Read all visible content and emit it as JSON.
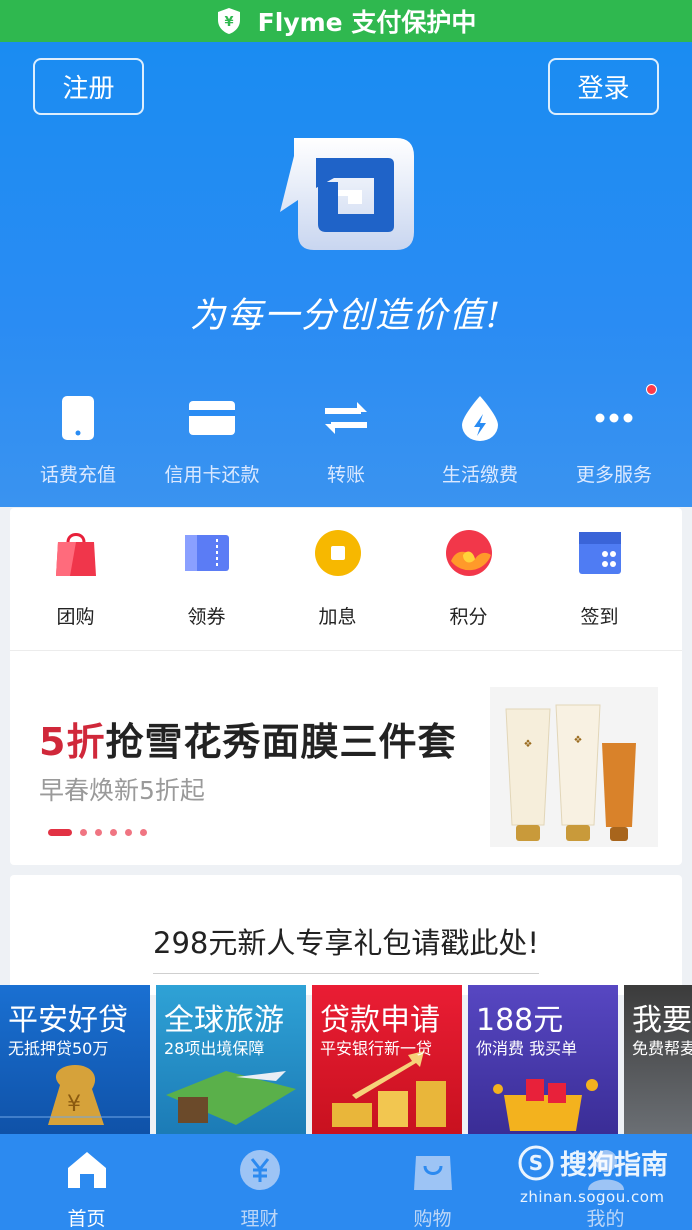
{
  "status_bar": {
    "text": "Flyme 支付保护中",
    "shield_glyph": "¥"
  },
  "header": {
    "register_label": "注册",
    "login_label": "登录",
    "slogan": "为每一分创造价值!"
  },
  "services": [
    {
      "label": "话费充值",
      "icon": "phone-icon"
    },
    {
      "label": "信用卡还款",
      "icon": "credit-card-icon"
    },
    {
      "label": "转账",
      "icon": "transfer-icon"
    },
    {
      "label": "生活缴费",
      "icon": "utility-drop-icon"
    },
    {
      "label": "更多服务",
      "icon": "more-icon",
      "badge": true
    }
  ],
  "quick_grid": [
    {
      "label": "团购",
      "icon": "shopping-bag-icon"
    },
    {
      "label": "领券",
      "icon": "coupon-icon"
    },
    {
      "label": "加息",
      "icon": "coin-icon"
    },
    {
      "label": "积分",
      "icon": "points-icon"
    },
    {
      "label": "签到",
      "icon": "calendar-icon"
    }
  ],
  "banner": {
    "highlight": "5折",
    "title": "抢雪花秀面膜三件套",
    "subtitle": "早春焕新5折起",
    "page_count": 6,
    "active_page": 1
  },
  "promo": {
    "text": "298元新人专享礼包请戳此处!"
  },
  "tiles": [
    {
      "title": "平安好贷",
      "subtitle": "无抵押贷50万",
      "color": "#1d6fd0"
    },
    {
      "title": "全球旅游",
      "subtitle": "28项出境保障",
      "color": "#2aa8d8"
    },
    {
      "title": "贷款申请",
      "subtitle": "平安银行新一贷",
      "color": "#e01d2f"
    },
    {
      "title": "188元",
      "subtitle": "你消费 我买单",
      "color": "#4b3fb0"
    },
    {
      "title": "我要",
      "subtitle": "免费帮麦",
      "color": "#3a3a3a"
    }
  ],
  "bottom_nav": [
    {
      "label": "首页",
      "icon": "home-icon",
      "active": true
    },
    {
      "label": "理财",
      "icon": "yuan-icon",
      "active": false
    },
    {
      "label": "购物",
      "icon": "bag-icon",
      "active": false
    },
    {
      "label": "我的",
      "icon": "user-icon",
      "active": false
    }
  ],
  "watermark": {
    "brand": "搜狗指南",
    "url": "zhinan.sogou.com"
  }
}
